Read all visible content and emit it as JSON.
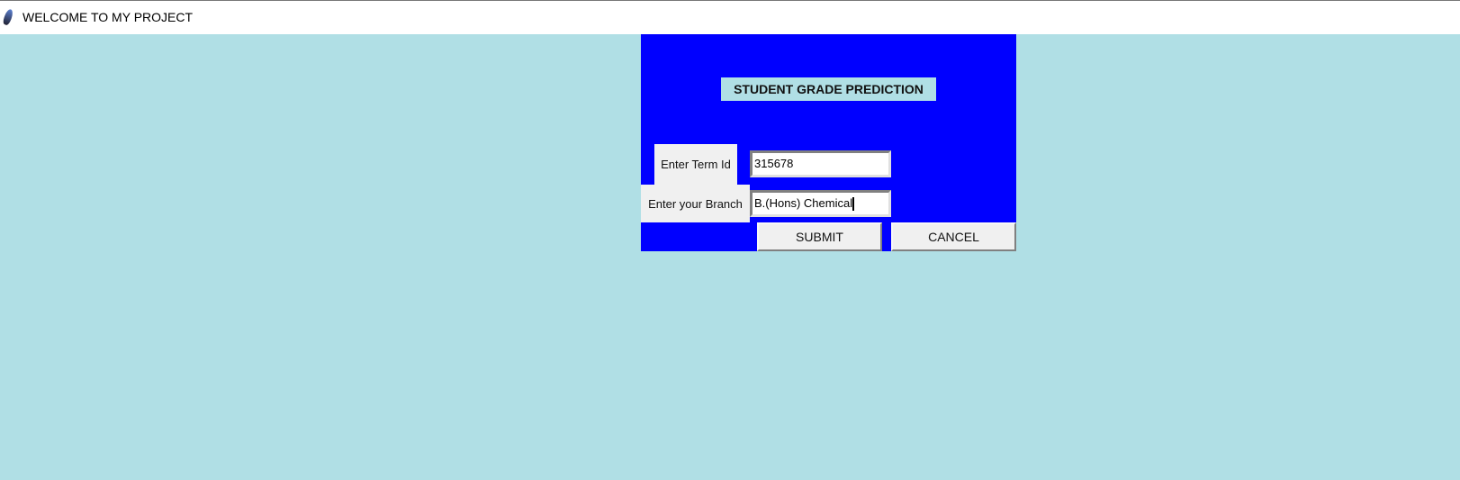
{
  "window": {
    "title": "WELCOME TO MY PROJECT",
    "icon": "feather-icon"
  },
  "form": {
    "heading": "STUDENT GRADE PREDICTION",
    "term_label": "Enter Term Id",
    "term_value": "315678",
    "branch_label": "Enter your Branch",
    "branch_value": "B.(Hons) Chemical",
    "submit_label": "SUBMIT",
    "cancel_label": "CANCEL"
  },
  "colors": {
    "background": "#b0dfe5",
    "panel": "#0000ff"
  }
}
